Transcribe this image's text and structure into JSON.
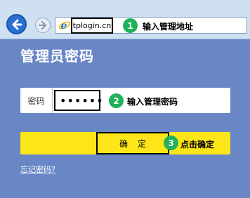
{
  "browser": {
    "url": "tplogin.cn"
  },
  "steps": [
    {
      "number": "1",
      "text": "输入管理地址"
    },
    {
      "number": "2",
      "text": "输入管理密码"
    },
    {
      "number": "3",
      "text": "点击确定"
    }
  ],
  "login": {
    "title": "管理员密码",
    "password_label": "密码",
    "password_value": "••••••",
    "confirm_label": "确定",
    "forgot_link": "忘记密码?"
  },
  "colors": {
    "page_background": "#6a87c5",
    "confirm_background": "#fce619",
    "step_badge": "#1fb25a",
    "back_button": "#2a6fd1"
  }
}
